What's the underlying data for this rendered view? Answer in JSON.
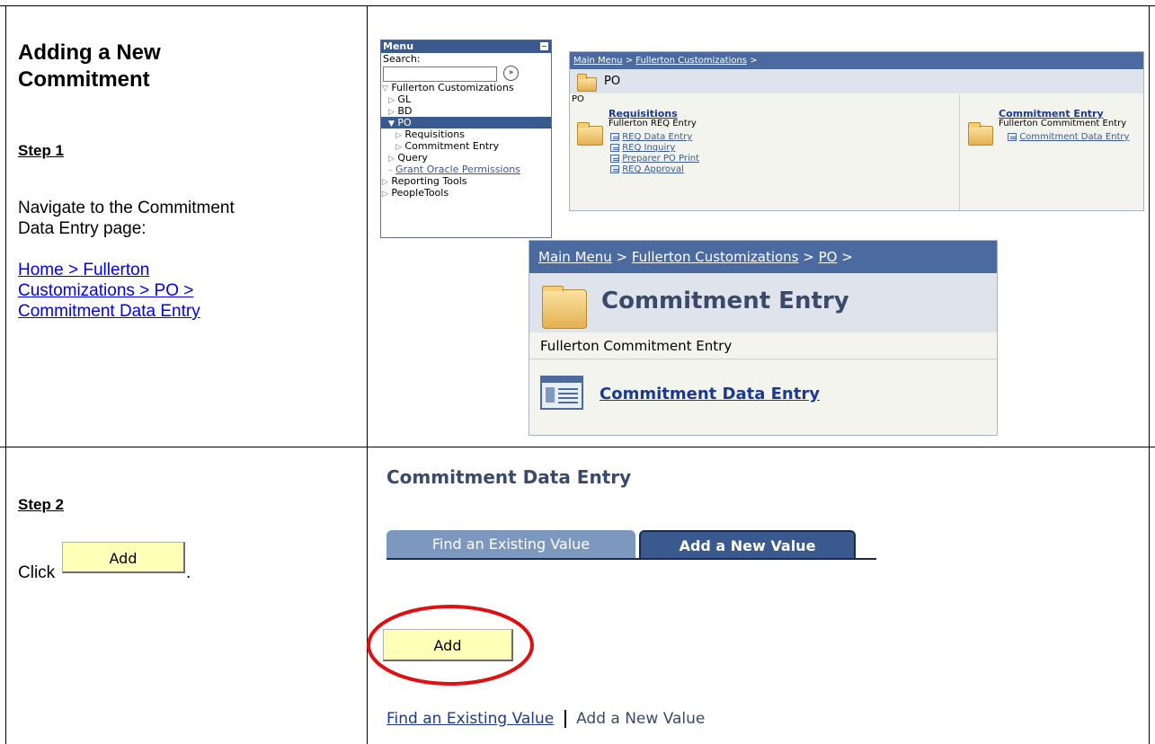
{
  "step1": {
    "heading": "Adding a New Commitment",
    "heading_line1": "Adding a New",
    "heading_line2": "Commitment",
    "step_label": "Step 1",
    "instruction_line1": "Navigate to the Commitment",
    "instruction_line2": "Data Entry page:",
    "path_line1": "Home > Fullerton",
    "path_line2": "Customizations > PO >",
    "path_line3": "Commitment Data Entry"
  },
  "menu": {
    "title": "Menu",
    "search_label": "Search:",
    "go_glyph": "»",
    "items": [
      {
        "label": "Fullerton Customizations",
        "marker": "▽"
      },
      {
        "label": "GL",
        "marker": "▷"
      },
      {
        "label": "BD",
        "marker": "▷"
      },
      {
        "label": "PO",
        "marker": "▼"
      },
      {
        "label": "Requisitions",
        "marker": "▷"
      },
      {
        "label": "Commitment Entry",
        "marker": "▷"
      },
      {
        "label": "Query",
        "marker": "▷"
      },
      {
        "label": "Grant Oracle Permissions",
        "marker": "–"
      },
      {
        "label": "Reporting Tools",
        "marker": "▷"
      },
      {
        "label": "PeopleTools",
        "marker": "▷"
      }
    ]
  },
  "po_panel": {
    "crumb_main": "Main Menu",
    "crumb_sep": " > ",
    "crumb_fullerton": "Fullerton Customizations",
    "crumb_end": " >",
    "title": "PO",
    "subtitle": "PO",
    "requisitions": {
      "title": "Requisitions",
      "desc": "Fullerton REQ Entry",
      "links": [
        "REQ Data Entry",
        "REQ Inquiry",
        "Preparer PO Print",
        "REQ Approval"
      ]
    },
    "commitment": {
      "title": "Commitment Entry",
      "desc": "Fullerton Commitment Entry",
      "link": "Commitment Data Entry"
    }
  },
  "ce_panel": {
    "crumb_main": "Main Menu",
    "crumb_fullerton": "Fullerton Customizations",
    "crumb_po": "PO",
    "sep": " > ",
    "end": " >",
    "title": "Commitment Entry",
    "desc": "Fullerton Commitment Entry",
    "link": "Commitment Data Entry"
  },
  "step2": {
    "step_label": "Step 2",
    "click_text": "Click",
    "period": ".",
    "button_label": "Add",
    "page_title": "Commitment Data Entry",
    "tab_find": "Find an Existing Value",
    "tab_add": "Add a New Value",
    "add_button": "Add",
    "bottom_find": "Find an Existing Value",
    "bottom_add": "Add a New Value"
  },
  "colors": {
    "highlight_circle": "#e01010",
    "button_fill": "#ffffb8",
    "crumb_bar": "#4a6aa0"
  }
}
